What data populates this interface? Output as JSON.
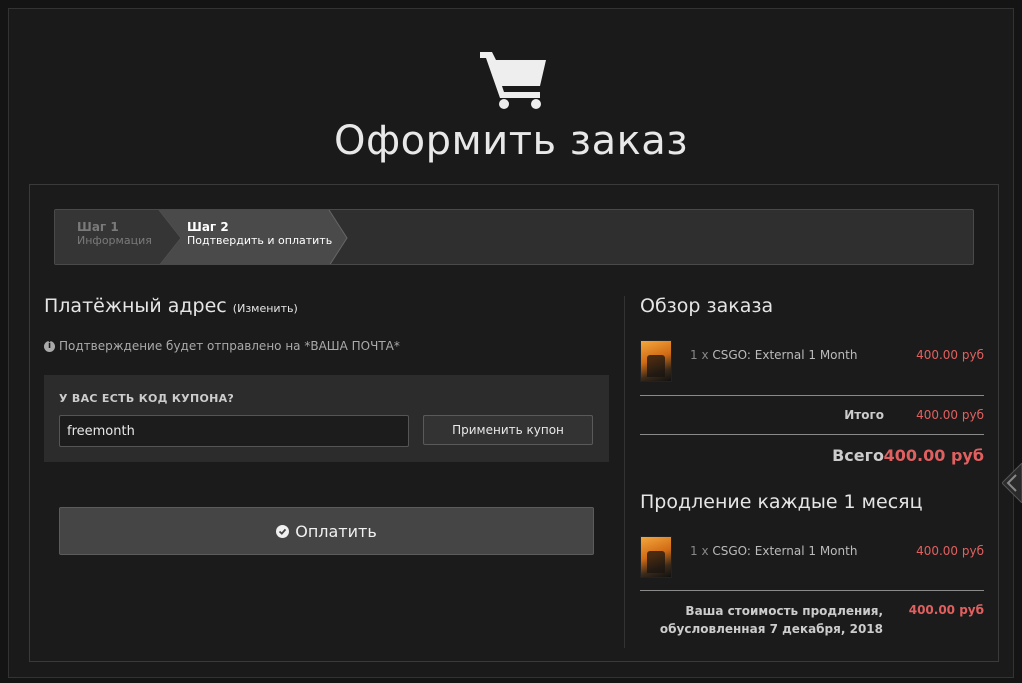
{
  "header": {
    "title": "Оформить заказ",
    "icon": "cart-icon"
  },
  "steps": [
    {
      "title": "Шаг 1",
      "subtitle": "Информация"
    },
    {
      "title": "Шаг 2",
      "subtitle": "Подтвердить и оплатить"
    }
  ],
  "billing": {
    "title": "Платёжный адрес",
    "change_link": "(Изменить)",
    "notice": "Подтверждение будет отправлено на *ВАША ПОЧТА*"
  },
  "coupon": {
    "label": "У ВАС ЕСТЬ КОД КУПОНА?",
    "value": "freemonth",
    "apply_label": "Применить купон"
  },
  "pay_button": {
    "label": "Оплатить"
  },
  "order_review": {
    "title": "Обзор заказа",
    "item": {
      "qty": "1 x",
      "name": "CSGO: External 1 Month",
      "price": "400.00 руб"
    },
    "subtotal_label": "Итого",
    "subtotal_value": "400.00 руб",
    "total_label": "Всего",
    "total_value": "400.00 руб"
  },
  "renewal": {
    "title": "Продление каждые 1 месяц",
    "item": {
      "qty": "1 x",
      "name": "CSGO: External 1 Month",
      "price": "400.00 руб"
    },
    "cost_label_line1": "Ваша стоимость продления,",
    "cost_label_line2": "обусловленная 7 декабря, 2018",
    "cost_value": "400.00 руб"
  },
  "colors": {
    "accent_price": "#e06060",
    "background": "#1a1a1a",
    "panel": "#2c2c2c"
  }
}
